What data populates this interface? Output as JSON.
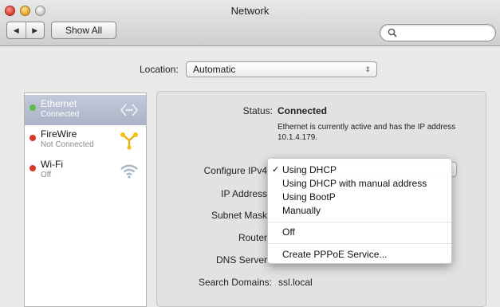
{
  "window": {
    "title": "Network"
  },
  "toolbar": {
    "back_glyph": "◀",
    "forward_glyph": "▶",
    "show_all_label": "Show All",
    "search_placeholder": ""
  },
  "location": {
    "label": "Location:",
    "value": "Automatic"
  },
  "services": [
    {
      "name": "Ethernet",
      "status": "Connected",
      "dot_color": "#5fbf4a",
      "icon": "ethernet-icon",
      "selected": true
    },
    {
      "name": "FireWire",
      "status": "Not Connected",
      "dot_color": "#d23a2c",
      "icon": "firewire-icon",
      "selected": false
    },
    {
      "name": "Wi-Fi",
      "status": "Off",
      "dot_color": "#d23a2c",
      "icon": "wifi-icon",
      "selected": false
    }
  ],
  "detail": {
    "status_label": "Status:",
    "status_value": "Connected",
    "status_desc": "Ethernet is currently active and has the IP address 10.1.4.179.",
    "configure_label": "Configure IPv4",
    "ip_label": "IP Address",
    "subnet_label": "Subnet Mask",
    "router_label": "Router",
    "dns_label": "DNS Server",
    "search_domains_label": "Search Domains:",
    "search_domains_value": "ssl.local"
  },
  "menu": {
    "check": "✓",
    "items": [
      "Using DHCP",
      "Using DHCP with manual address",
      "Using BootP",
      "Manually",
      "Off",
      "Create PPPoE Service..."
    ]
  },
  "colors": {
    "selection": "#aab3c8",
    "connected": "#5fbf4a",
    "disconnected": "#d23a2c"
  }
}
